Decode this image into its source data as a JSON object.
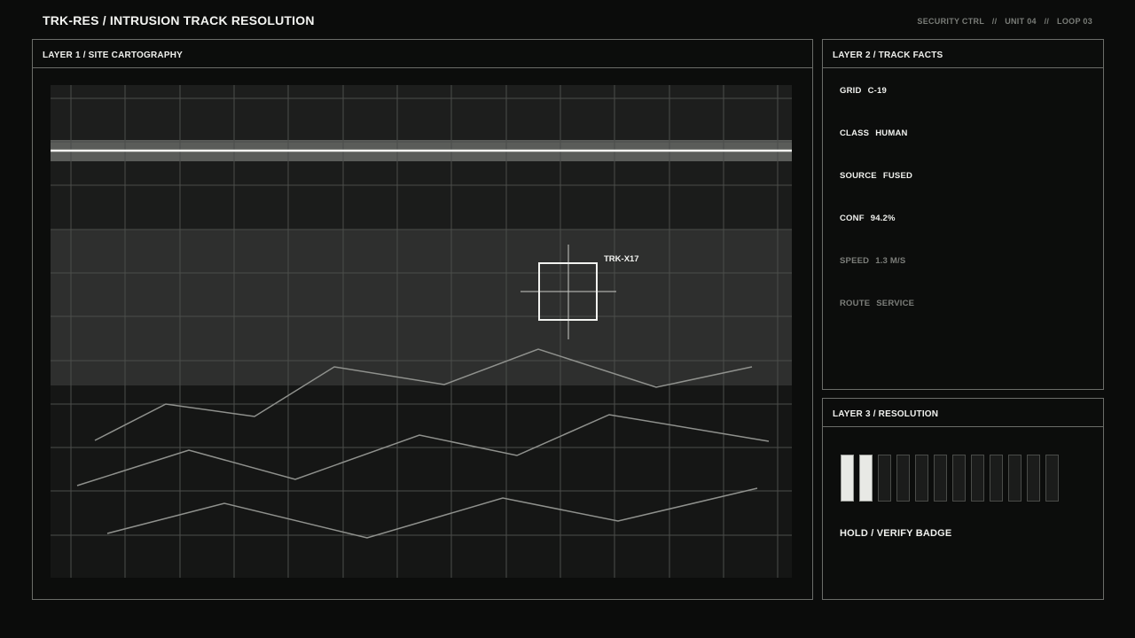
{
  "header": {
    "title": "TRK-RES / INTRUSION TRACK RESOLUTION",
    "meta": [
      "SECURITY CTRL",
      "UNIT 04",
      "LOOP 03"
    ],
    "separator": "//"
  },
  "map_panel": {
    "title": "LAYER 1 / SITE CARTOGRAPHY",
    "target_label": "TRK-X17"
  },
  "facts_panel": {
    "title": "LAYER 2 / TRACK FACTS",
    "rows": [
      {
        "key": "GRID",
        "value": "C-19",
        "emphasis": "bright"
      },
      {
        "key": "CLASS",
        "value": "HUMAN",
        "emphasis": "bright"
      },
      {
        "key": "SOURCE",
        "value": "FUSED",
        "emphasis": "bright"
      },
      {
        "key": "CONF",
        "value": "94.2%",
        "emphasis": "bright"
      },
      {
        "key": "SPEED",
        "value": "1.3 M/S",
        "emphasis": "dim"
      },
      {
        "key": "ROUTE",
        "value": "SERVICE",
        "emphasis": "dim"
      }
    ]
  },
  "resolution_panel": {
    "title": "LAYER 3 / RESOLUTION",
    "meter": {
      "segments_total": 12,
      "segments_filled": 2
    },
    "status": "HOLD / VERIFY BADGE"
  },
  "colors": {
    "background": "#0b0c0b",
    "panel_border": "#6b6d69",
    "text_primary": "#f0f1ee",
    "text_dim": "#7c7e7a",
    "meter_on": "#e8e9e5",
    "meter_off": "#1b1c1b"
  }
}
